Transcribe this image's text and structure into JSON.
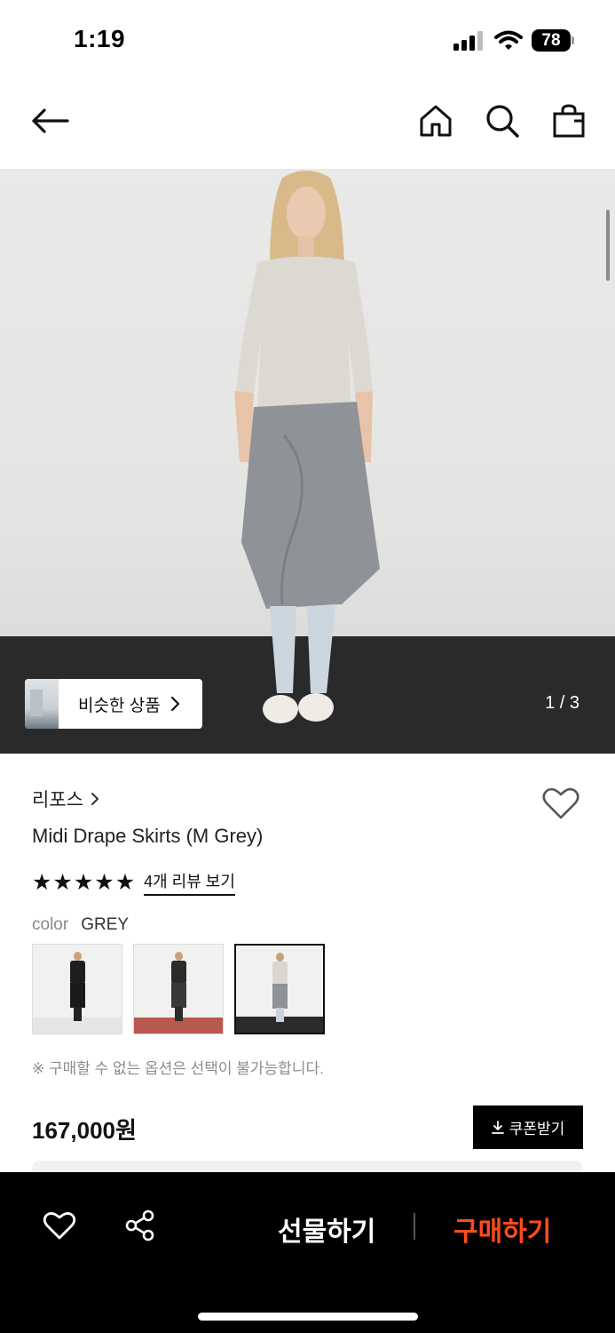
{
  "status_bar": {
    "time": "1:19",
    "battery": "78"
  },
  "nav": {
    "back_icon": "arrow-left-icon",
    "home_icon": "home-icon",
    "search_icon": "search-icon",
    "bag_icon": "shopping-bag-icon"
  },
  "hero": {
    "similar_label": "비슷한 상품",
    "page_indicator": "1 / 3"
  },
  "product": {
    "brand": "리포스",
    "title": "Midi Drape Skirts (M Grey)",
    "rating": 5,
    "review_link": "4개 리뷰 보기",
    "color_label": "color",
    "color_value": "GREY",
    "notice": "※ 구매할 수 없는 옵션은 선택이 불가능합니다.",
    "price": "167,000원",
    "coupon_label": "쿠폰받기"
  },
  "swatches": [
    {
      "selected": false,
      "top": "#1e1e1e",
      "skirt": "#1a1a1a",
      "legs": "#222222",
      "floor": "#e6e6e5"
    },
    {
      "selected": false,
      "top": "#2d2a2a",
      "skirt": "#3a3838",
      "legs": "#2a2a2a",
      "floor": "#b8584f"
    },
    {
      "selected": true,
      "top": "#d9d7d2",
      "skirt": "#8e9196",
      "legs": "#c7d3de",
      "floor": "#2a2a2b"
    }
  ],
  "bottom_bar": {
    "gift_label": "선물하기",
    "buy_label": "구매하기",
    "buy_color": "#ff4b1c"
  }
}
